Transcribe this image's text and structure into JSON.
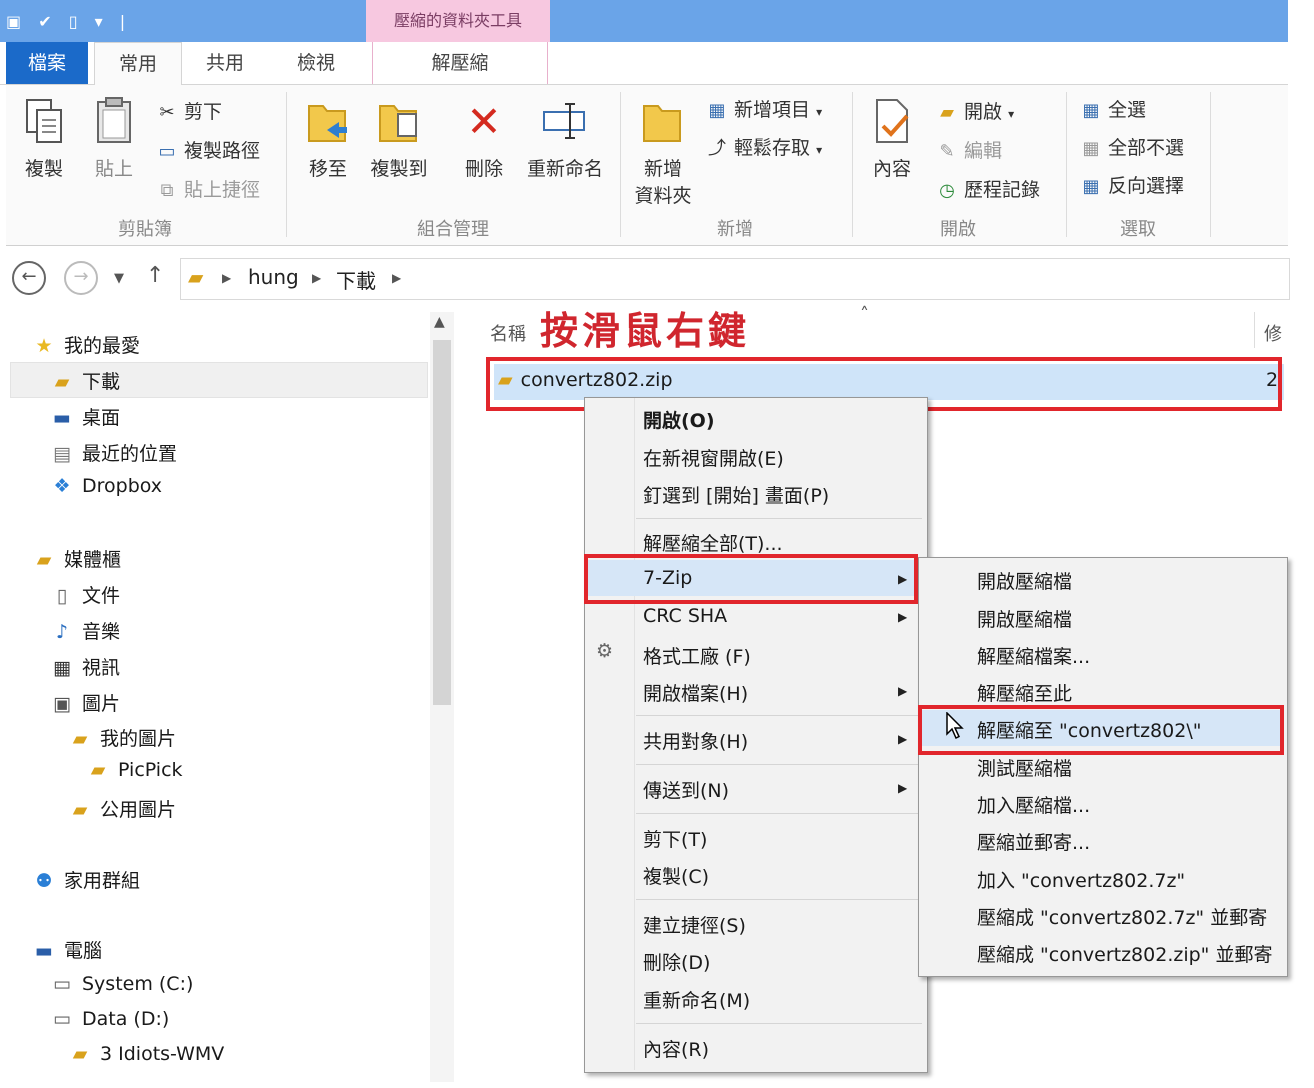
{
  "title_bar": {
    "context_tab_header": "壓縮的資料夾工具"
  },
  "tabs": [
    "檔案",
    "常用",
    "共用",
    "檢視",
    "解壓縮"
  ],
  "ribbon": {
    "clipboard": {
      "copy": "複製",
      "paste": "貼上",
      "cut": "剪下",
      "copy_path": "複製路徑",
      "paste_shortcut": "貼上捷徑",
      "label": "剪貼簿"
    },
    "organize": {
      "move_to": "移至",
      "copy_to": "複製到",
      "delete": "刪除",
      "rename": "重新命名",
      "label": "組合管理"
    },
    "new": {
      "new_folder_line1": "新增",
      "new_folder_line2": "資料夾",
      "new_item": "新增項目",
      "easy_access": "輕鬆存取",
      "label": "新增"
    },
    "open": {
      "properties": "內容",
      "open": "開啟",
      "edit": "編輯",
      "history": "歷程記錄",
      "label": "開啟"
    },
    "select": {
      "select_all": "全選",
      "select_none": "全部不選",
      "invert": "反向選擇",
      "label": "選取"
    }
  },
  "address": {
    "crumbs": [
      "hung",
      "下載"
    ]
  },
  "nav": {
    "favorites": "我的最愛",
    "downloads": "下載",
    "desktop": "桌面",
    "recent": "最近的位置",
    "dropbox": "Dropbox",
    "libraries": "媒體櫃",
    "documents": "文件",
    "music": "音樂",
    "videos": "視訊",
    "pictures": "圖片",
    "my_pictures": "我的圖片",
    "picpick": "PicPick",
    "public_pictures": "公用圖片",
    "homegroup": "家用群組",
    "computer": "電腦",
    "system_c": "System (C:)",
    "data_d": "Data (D:)",
    "idiots": "3 Idiots-WMV"
  },
  "file_list": {
    "col_name": "名稱",
    "col_modified": "修",
    "annotation": "按滑鼠右鍵",
    "file": "convertz802.zip",
    "file_extra": "2"
  },
  "context_menu": {
    "open": "開啟(O)",
    "open_new_window": "在新視窗開啟(E)",
    "pin_start": "釘選到 [開始] 畫面(P)",
    "extract_all": "解壓縮全部(T)...",
    "sevenzip": "7-Zip",
    "crc_sha": "CRC SHA",
    "format_factory": "格式工廠 (F)",
    "open_with": "開啟檔案(H)",
    "share_with": "共用對象(H)",
    "send_to": "傳送到(N)",
    "cut": "剪下(T)",
    "copy": "複製(C)",
    "create_shortcut": "建立捷徑(S)",
    "delete": "刪除(D)",
    "rename": "重新命名(M)",
    "properties": "內容(R)"
  },
  "submenu": {
    "open_archive_1": "開啟壓縮檔",
    "open_archive_2": "開啟壓縮檔",
    "extract_files": "解壓縮檔案...",
    "extract_here": "解壓縮至此",
    "extract_to": "解壓縮至 \"convertz802\\\"",
    "test_archive": "測試壓縮檔",
    "add_to_archive": "加入壓縮檔...",
    "compress_email": "壓縮並郵寄...",
    "add_to_7z": "加入 \"convertz802.7z\"",
    "compress_7z_email": "壓縮成 \"convertz802.7z\" 並郵寄",
    "compress_zip_email": "壓縮成 \"convertz802.zip\" 並郵寄"
  },
  "colors": {
    "highlight_red": "#e1262c",
    "accent_blue": "#1b6ac9",
    "selection_blue": "#cfe4f9"
  }
}
